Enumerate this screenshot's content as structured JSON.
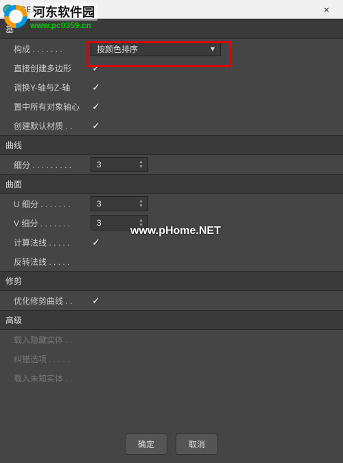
{
  "titlebar": {
    "title": "IGES",
    "close": "×"
  },
  "sections": {
    "basic": {
      "header": "基",
      "composition_label": "构成 . . . . . . .",
      "composition_value": "按颜色排序",
      "create_poly_label": "直接创建多边形",
      "create_poly_checked": true,
      "swap_yz_label": "调换Y-轴与Z-轴",
      "swap_yz_checked": true,
      "center_label": "置中所有对象轴心",
      "center_checked": true,
      "default_mat_label": "创建默认材质 . .",
      "default_mat_checked": true
    },
    "curve": {
      "header": "曲线",
      "subdiv_label": "细分 . . . . . . . . .",
      "subdiv_value": "3"
    },
    "surface": {
      "header": "曲面",
      "u_label": "U 细分 . . . . . . .",
      "u_value": "3",
      "v_label": "V 细分 . . . . . . .",
      "v_value": "3",
      "compute_normal_label": "计算法线 . . . . .",
      "compute_normal_checked": true,
      "invert_normal_label": "反转法线 . . . . .",
      "invert_normal_checked": false
    },
    "trim": {
      "header": "修剪",
      "optimize_label": "优化修剪曲线 . .",
      "optimize_checked": true
    },
    "advanced": {
      "header": "高级",
      "load_hidden_label": "载入隐藏实体 . .",
      "load_hidden_checked": false,
      "error_opts_label": "纠错选项 . . . . .",
      "error_opts_checked": false,
      "load_unknown_label": "载入未知实体 . .",
      "load_unknown_checked": false
    }
  },
  "footer": {
    "ok": "确定",
    "cancel": "取消"
  },
  "watermarks": {
    "logo_cn": "河东软件园",
    "logo_url": "www.pc0359.cn",
    "center": "www.pHome.NET"
  }
}
